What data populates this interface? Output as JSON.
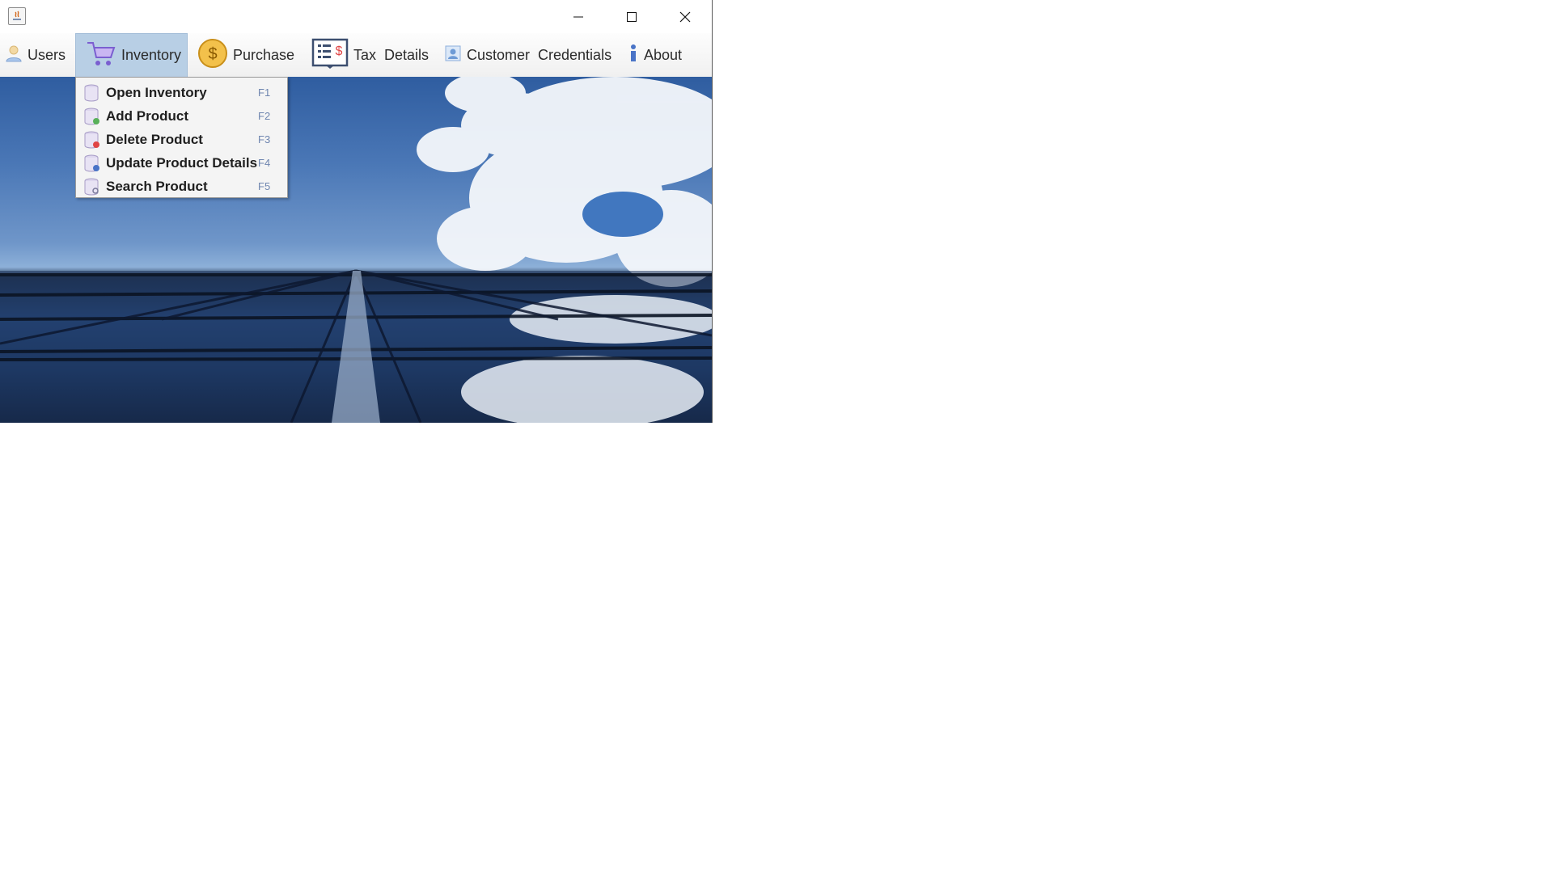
{
  "window": {
    "controls": {
      "minimize": "minimize",
      "maximize": "maximize",
      "close": "close"
    }
  },
  "menubar": {
    "items": [
      {
        "label": "Users",
        "icon": "user-icon"
      },
      {
        "label": "Inventory",
        "icon": "cart-icon",
        "active": true
      },
      {
        "label": "Purchase",
        "icon": "dollar-coin-icon"
      },
      {
        "label": "Tax  Details",
        "icon": "tax-document-icon"
      },
      {
        "label": "Customer  Credentials",
        "icon": "contact-card-icon"
      },
      {
        "label": "About",
        "icon": "info-icon"
      }
    ]
  },
  "dropdown": {
    "items": [
      {
        "label": "Open Inventory",
        "accelerator": "F1",
        "icon": "database-icon"
      },
      {
        "label": "Add Product",
        "accelerator": "F2",
        "icon": "database-add-icon"
      },
      {
        "label": "Delete Product",
        "accelerator": "F3",
        "icon": "database-delete-icon"
      },
      {
        "label": "Update Product Details",
        "accelerator": "F4",
        "icon": "database-edit-icon"
      },
      {
        "label": "Search Product",
        "accelerator": "F5",
        "icon": "database-search-icon"
      }
    ]
  },
  "colors": {
    "menu_active": "#b8cfe5",
    "dropdown_bg": "#f4f4f4",
    "accelerator": "#6f86b0"
  }
}
